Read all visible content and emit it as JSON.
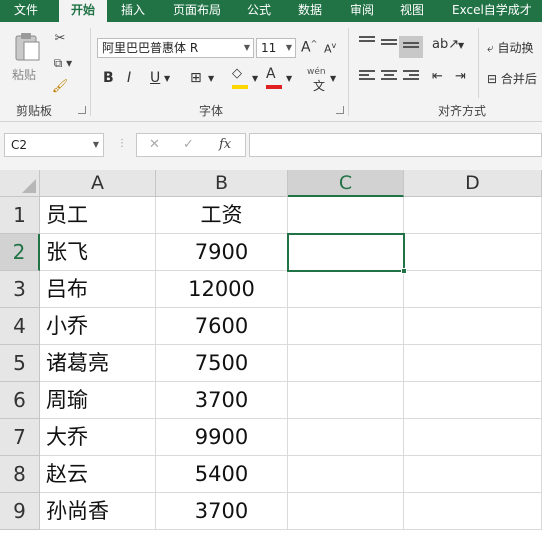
{
  "tabs": [
    "文件",
    "开始",
    "插入",
    "页面布局",
    "公式",
    "数据",
    "审阅",
    "视图",
    "Excel自学成才"
  ],
  "ribbon": {
    "clipboard": {
      "paste_label": "粘贴",
      "group_label": "剪贴板"
    },
    "font": {
      "font_name": "阿里巴巴普惠体 R",
      "font_size": "11",
      "bold": "B",
      "italic": "I",
      "underline": "U",
      "grow": "A",
      "shrink": "A",
      "font_color_glyph": "A",
      "phonetic_glyph": "wén",
      "group_label": "字体"
    },
    "alignment": {
      "wrap_label": "自动换",
      "merge_label": "合并后",
      "group_label": "对齐方式"
    }
  },
  "formula_bar": {
    "name_box": "C2",
    "cancel": "✕",
    "enter": "✓",
    "fx": "fx",
    "formula": ""
  },
  "grid": {
    "columns": [
      "A",
      "B",
      "C",
      "D"
    ],
    "rows": [
      "1",
      "2",
      "3",
      "4",
      "5",
      "6",
      "7",
      "8",
      "9"
    ],
    "cells": [
      [
        "员工",
        "工资"
      ],
      [
        "张飞",
        "7900"
      ],
      [
        "吕布",
        "12000"
      ],
      [
        "小乔",
        "7600"
      ],
      [
        "诸葛亮",
        "7500"
      ],
      [
        "周瑜",
        "3700"
      ],
      [
        "大乔",
        "9900"
      ],
      [
        "赵云",
        "5400"
      ],
      [
        "孙尚香",
        "3700"
      ]
    ],
    "active_cell": "C2"
  },
  "colors": {
    "accent": "#217346",
    "font_color": "#e02020",
    "fill_color": "#ffd700"
  }
}
